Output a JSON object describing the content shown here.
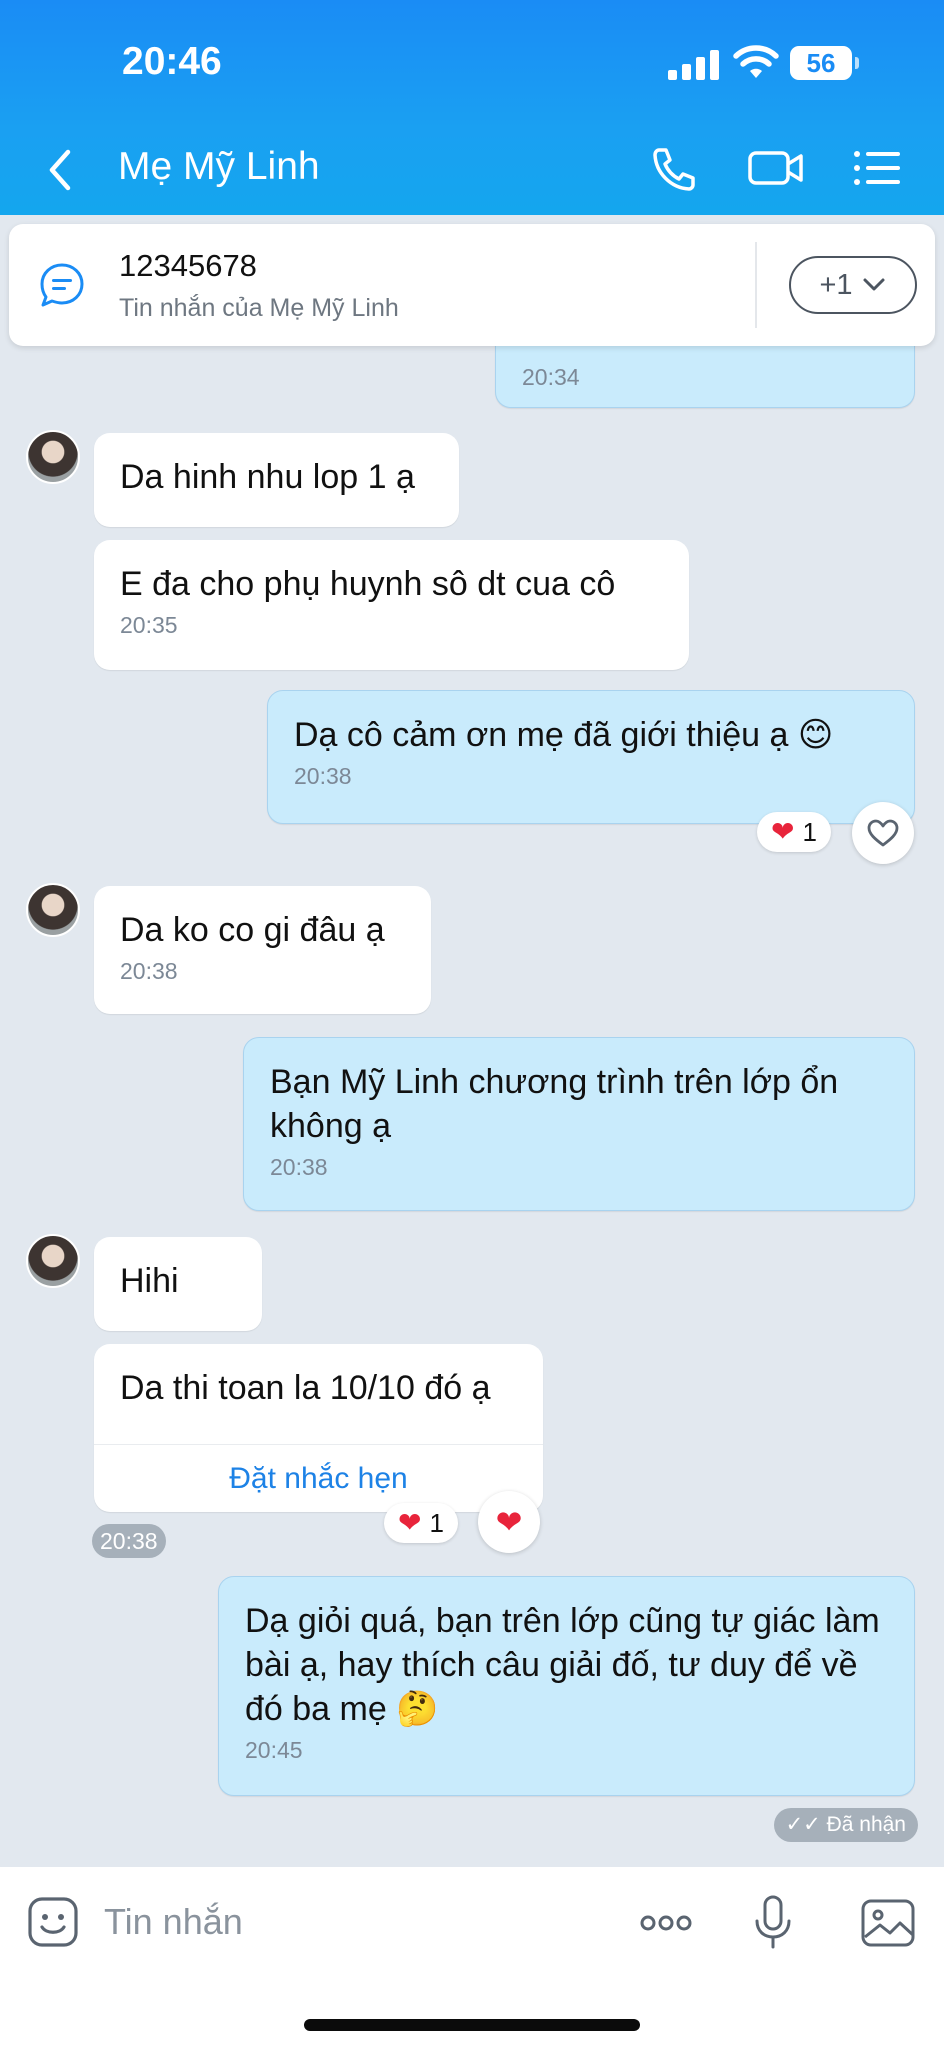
{
  "status_bar": {
    "time": "20:46",
    "battery": "56"
  },
  "header": {
    "title": "Mẹ Mỹ Linh"
  },
  "pinned": {
    "title": "12345678",
    "subtitle": "Tin nhắn của Mẹ Mỹ Linh",
    "more_label": "+1"
  },
  "messages": [
    {
      "side": "out",
      "text": "",
      "time": "20:34"
    },
    {
      "side": "in",
      "text": "Da hinh nhu lop 1 ạ",
      "time": ""
    },
    {
      "side": "in",
      "text": "E đa cho phụ huynh sô dt cua cô",
      "time": "20:35"
    },
    {
      "side": "out",
      "text": "Dạ cô cảm ơn mẹ đã giới thiệu ạ 😊",
      "time": "20:38",
      "reaction_count": "1"
    },
    {
      "side": "in",
      "text": "Da ko co gi đâu ạ",
      "time": "20:38"
    },
    {
      "side": "out",
      "text": "Bạn Mỹ Linh chương trình trên lớp ổn không ạ",
      "time": "20:38"
    },
    {
      "side": "in",
      "text": "Hihi",
      "time": ""
    },
    {
      "side": "in",
      "text": "Da thi toan la 10/10 đó ạ",
      "time": "20:38",
      "action": "Đặt nhắc hẹn",
      "reaction_count": "1"
    },
    {
      "side": "out",
      "text": "Dạ giỏi quá, bạn trên lớp cũng tự giác làm bài ạ, hay thích câu giải đố, tư duy để về đó ba mẹ 🤔",
      "time": "20:45"
    }
  ],
  "received_label": "Đã nhận",
  "composer": {
    "placeholder": "Tin nhắn"
  },
  "colors": {
    "accent": "#1a8cf5",
    "out_bubble": "#c9ebfc",
    "link": "#1d82e6",
    "heart": "#e8243b"
  }
}
